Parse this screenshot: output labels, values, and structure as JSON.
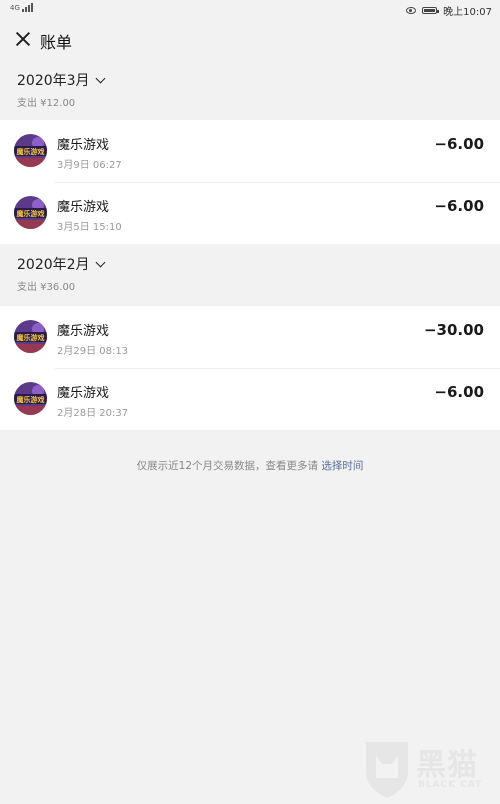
{
  "status_bar": {
    "signal_text": "4G",
    "time_text": "晚上10:07"
  },
  "header": {
    "title": "账单"
  },
  "months": [
    {
      "label": "2020年3月",
      "summary": "支出 ¥12.00",
      "transactions": [
        {
          "merchant": "魔乐游戏",
          "time": "3月9日 06:27",
          "amount": "−6.00"
        },
        {
          "merchant": "魔乐游戏",
          "time": "3月5日 15:10",
          "amount": "−6.00"
        }
      ]
    },
    {
      "label": "2020年2月",
      "summary": "支出 ¥36.00",
      "transactions": [
        {
          "merchant": "魔乐游戏",
          "time": "2月29日 08:13",
          "amount": "−30.00"
        },
        {
          "merchant": "魔乐游戏",
          "time": "2月28日 20:37",
          "amount": "−6.00"
        }
      ]
    }
  ],
  "footer": {
    "note": "仅展示近12个月交易数据，查看更多请",
    "link": "选择时间"
  },
  "watermark": {
    "cn": "黑猫",
    "en": "BLACK CAT"
  },
  "colors": {
    "background": "#f2f2f2",
    "link": "#576b95",
    "avatar_bg": "#5b3a8a"
  }
}
